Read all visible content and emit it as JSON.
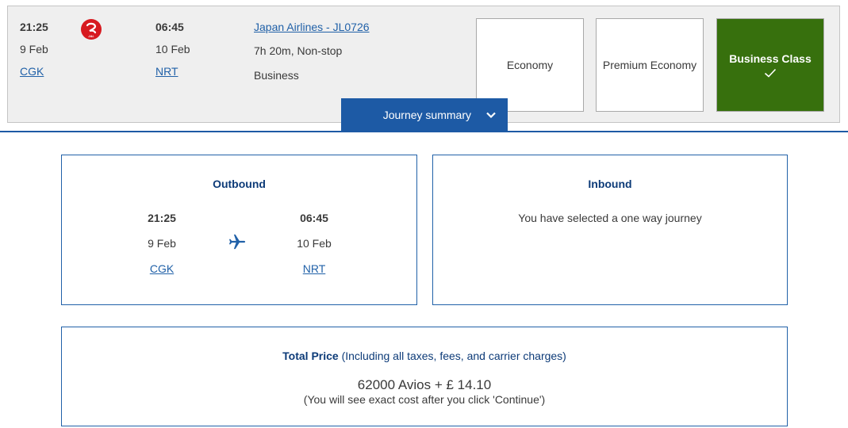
{
  "flight": {
    "departure": {
      "time": "21:25",
      "date": "9 Feb",
      "airport": "CGK"
    },
    "arrival": {
      "time": "06:45",
      "date": "10 Feb",
      "airport": "NRT"
    },
    "airline_logo": "jal-crane-logo",
    "airline_link": "Japan Airlines - JL0726",
    "duration": "7h 20m, Non-stop",
    "cabin": "Business"
  },
  "fares": [
    {
      "label": "Economy",
      "selected": false
    },
    {
      "label": "Premium Economy",
      "selected": false
    },
    {
      "label": "Business Class",
      "selected": true,
      "icon": "checkmark-icon"
    }
  ],
  "journey_summary": {
    "label": "Journey summary",
    "icon": "chevron-down-icon"
  },
  "outbound": {
    "heading": "Outbound",
    "departure": {
      "time": "21:25",
      "date": "9 Feb",
      "airport": "CGK"
    },
    "arrival": {
      "time": "06:45",
      "date": "10 Feb",
      "airport": "NRT"
    },
    "icon": "airplane-icon"
  },
  "inbound": {
    "heading": "Inbound",
    "message": "You have selected a one way journey"
  },
  "price": {
    "label_bold": "Total Price",
    "label_rest": " (Including all taxes, fees, and carrier charges)",
    "amount": "62000 Avios + £ 14.10",
    "note": "(You will see exact cost after you click 'Continue')"
  },
  "colors": {
    "brand_blue": "#1d5aa5",
    "heading_navy": "#0d3b78",
    "selected_green": "#37700d",
    "logo_red": "#d7191f"
  }
}
